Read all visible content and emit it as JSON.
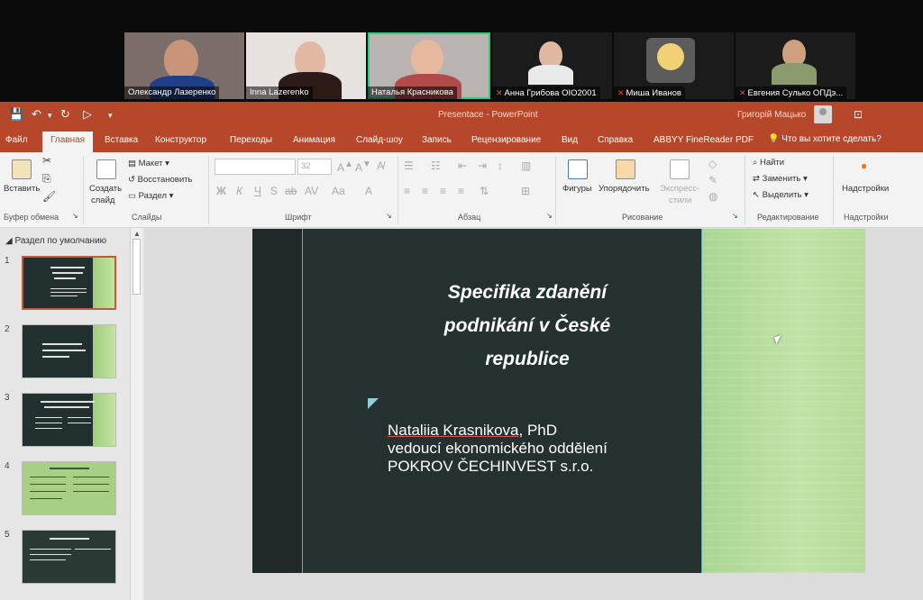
{
  "participants": [
    {
      "name": "Олександр Лазеренко",
      "muted": false,
      "active": false,
      "bg": "#7a6d6a",
      "skin": "#c99578",
      "hair": "#3a2a22",
      "shirt": "#1f3f8a"
    },
    {
      "name": "Inna Lazerenko",
      "muted": false,
      "active": false,
      "bg": "#e8e2df",
      "skin": "#e2b8a3",
      "hair": "#2b1a16",
      "shirt": "#2b1a16"
    },
    {
      "name": "Наталья Красникова",
      "muted": false,
      "active": true,
      "bg": "#b9b4b2",
      "skin": "#e6b89d",
      "hair": "#2a1c18",
      "shirt": "#b34a4a"
    },
    {
      "name": "Анна Грибова OIO2001",
      "muted": true,
      "active": false,
      "bg": "#1b1b1b",
      "skin": "#e0b7a0",
      "hair": "#2a1d1a",
      "shirt": "#eaeaea"
    },
    {
      "name": "Миша Иванов",
      "muted": true,
      "active": false,
      "bg": "#1b1b1b",
      "skin": "#f0c040",
      "hair": "#5a3a1a",
      "shirt": "#f6f6f6"
    },
    {
      "name": "Евгения Сулько ОПДэ...",
      "muted": true,
      "active": false,
      "bg": "#1b1b1b",
      "skin": "#cfa080",
      "hair": "#2e2a26",
      "shirt": "#8a9a6a"
    }
  ],
  "titlebar": {
    "document": "Presentace - PowerPoint",
    "user": "Григорій Мацько"
  },
  "tabs": [
    "Файл",
    "Главная",
    "Вставка",
    "Конструктор",
    "Переходы",
    "Анимация",
    "Слайд-шоу",
    "Запись",
    "Рецензирование",
    "Вид",
    "Справка",
    "ABBYY FineReader PDF"
  ],
  "active_tab": "Главная",
  "tell_me": "Что вы хотите сделать?",
  "ribbon": {
    "paste": "Вставить",
    "new_slide_1": "Создать",
    "new_slide_2": "слайд",
    "layout": "Макет",
    "reset": "Восстановить",
    "section": "Раздел",
    "font_size": "32",
    "shapes": "Фигуры",
    "arrange": "Упорядочить",
    "quick_styles_1": "Экспресс-",
    "quick_styles_2": "стили",
    "find": "Найти",
    "replace": "Заменить",
    "select": "Выделить",
    "addins": "Надстройки",
    "groups": {
      "clipboard": "Буфер обмена",
      "slides": "Слайды",
      "font": "Шрифт",
      "paragraph": "Абзац",
      "drawing": "Рисование",
      "editing": "Редактирование",
      "addins": "Надстройки"
    }
  },
  "thumbnails": {
    "section": "Раздел по умолчанию",
    "numbers": [
      "1",
      "2",
      "3",
      "4",
      "5"
    ]
  },
  "slide": {
    "title": "Specifika zdanění podnikání v České republice",
    "author": "Nataliia Krasnikova",
    "degree": ", PhD",
    "position": "vedoucí ekonomického oddělení",
    "company": "POKROV ČECHINVEST s.r.o."
  },
  "colors": {
    "accent": "#b7472a",
    "slide_dark": "#253130",
    "slide_green": "#b4dc98",
    "active_speaker": "#27d07a"
  }
}
